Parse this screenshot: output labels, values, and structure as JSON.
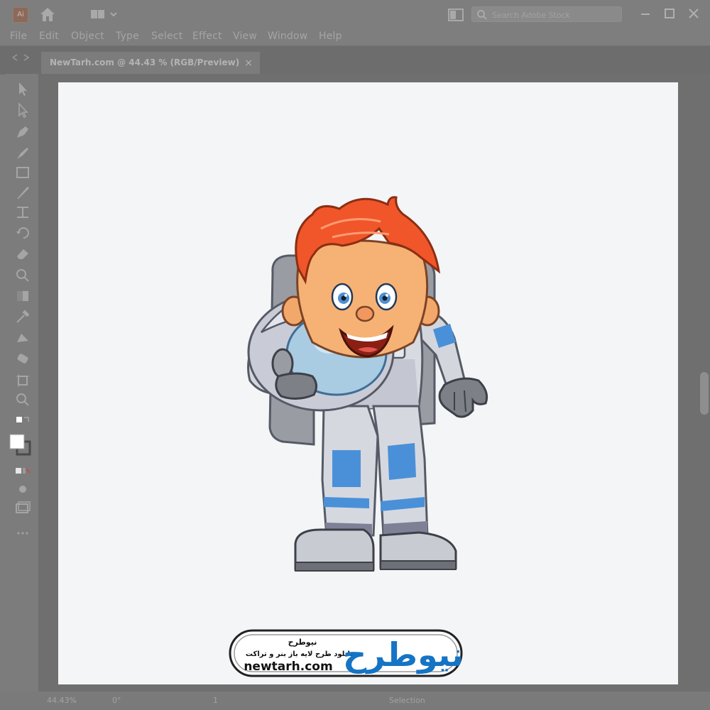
{
  "app": {
    "logo_text": "Ai"
  },
  "search": {
    "placeholder": "Search Adobe Stock"
  },
  "menu": {
    "items": [
      "File",
      "Edit",
      "Object",
      "Type",
      "Select",
      "Effect",
      "View",
      "Window",
      "Help"
    ]
  },
  "document": {
    "tab_title": "NewTarh.com @ 44.43 % (RGB/Preview)",
    "close_glyph": "×"
  },
  "status": {
    "zoom": "44.43%",
    "rotation": "0°",
    "artboard": "1",
    "mode": "Selection"
  },
  "watermark": {
    "site_name_fa": "نیوطرح",
    "tagline_fa": "دانلود طرح لایه باز بنر و تراکت",
    "url": "newtarh.com",
    "logo_fa": "نیوطرح"
  },
  "colors": {
    "chrome": "#7c7c7c",
    "artboard": "#f4f5f6",
    "hair": "#f0562a",
    "suit": "#d2d4dc",
    "suit_accent": "#4a90d8",
    "visor": "#a9cce3",
    "brand_blue": "#1574c4"
  }
}
